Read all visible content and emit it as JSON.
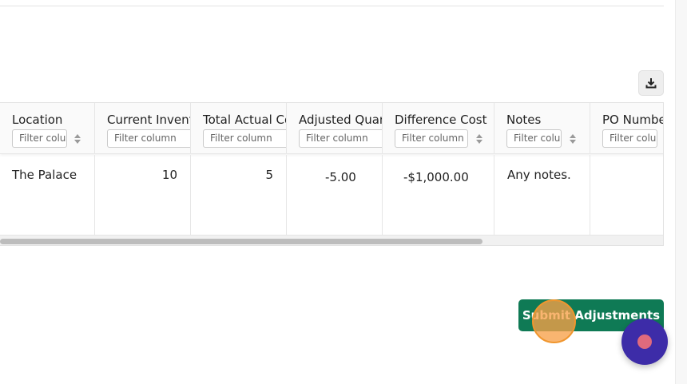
{
  "toolbar": {
    "download_icon": "download-icon"
  },
  "table": {
    "filter_placeholder": "Filter column",
    "columns": [
      {
        "label": "Location"
      },
      {
        "label": "Current Inventory"
      },
      {
        "label": "Total Actual Cost"
      },
      {
        "label": "Adjusted Quantity"
      },
      {
        "label": "Difference Cost"
      },
      {
        "label": "Notes"
      },
      {
        "label": "PO Number"
      }
    ],
    "rows": [
      {
        "location": "The Palace",
        "current_inventory": "10",
        "total_actual_cost": "5",
        "adjusted_quantity": "-5.00",
        "difference_cost": "-$1,000.00",
        "notes": "Any notes.",
        "po_number": ""
      }
    ]
  },
  "actions": {
    "submit_label": "Submit Adjustments"
  },
  "colors": {
    "submit": "#0f7a55",
    "chat_launcher": "#3d2ca8",
    "chat_dot": "#e06a7d",
    "click_ring": "#f7a048"
  }
}
